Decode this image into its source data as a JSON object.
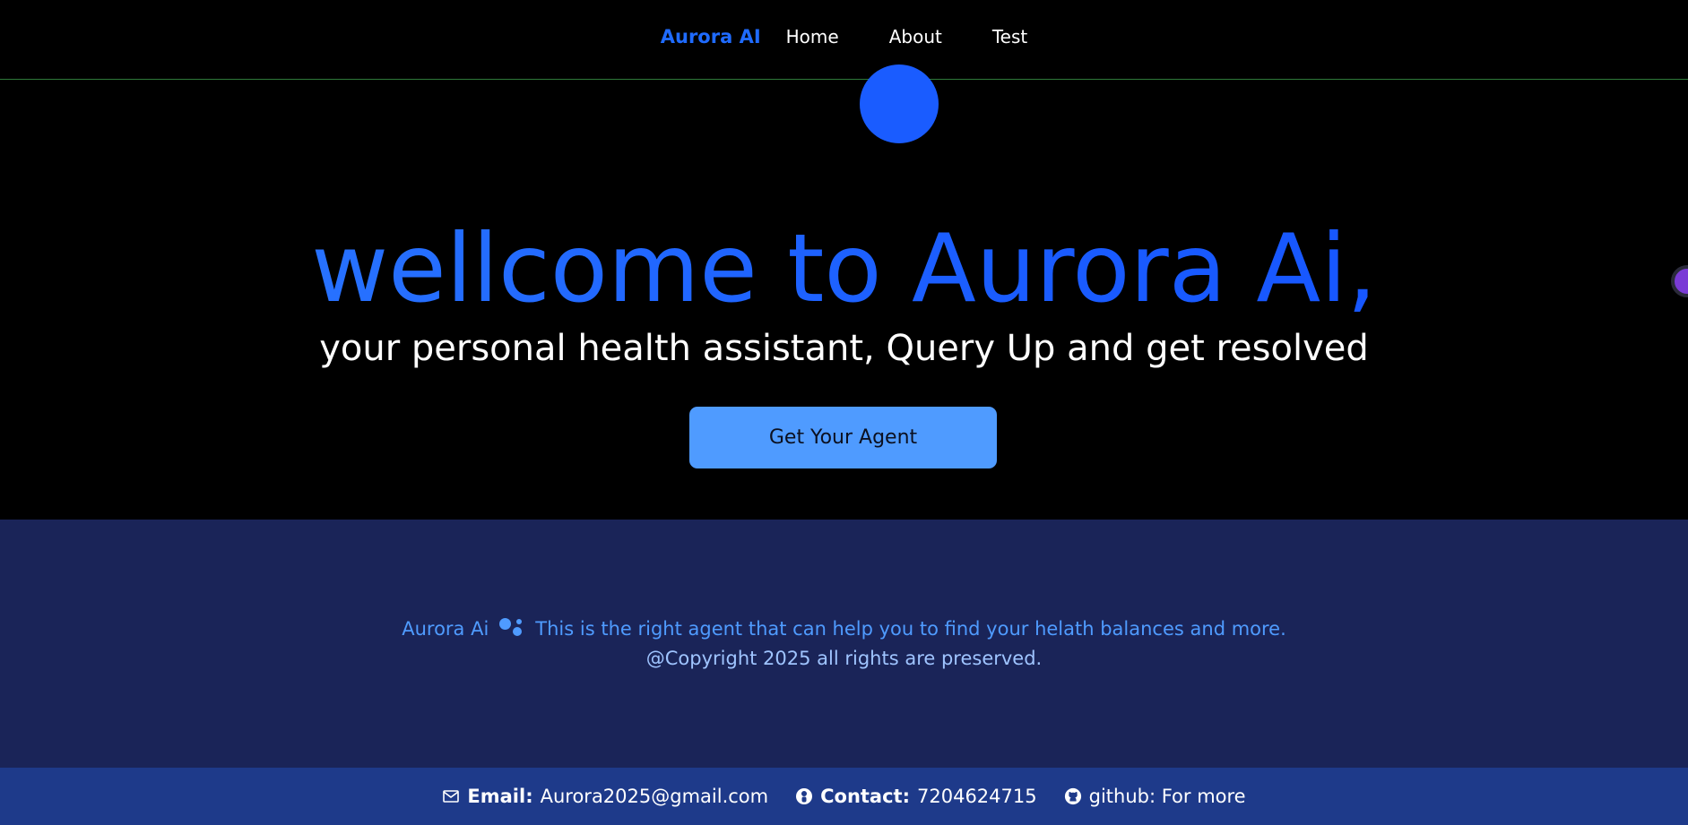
{
  "nav": {
    "brand": "Aurora AI",
    "links": [
      "Home",
      "About",
      "Test"
    ]
  },
  "hero": {
    "title": "wellcome to Aurora Ai,",
    "subtitle": "your personal health assistant, Query Up and get resolved",
    "cta_label": "Get Your Agent"
  },
  "info": {
    "brand": "Aurora Ai",
    "tagline": "This is the right agent that can help you to find your helath balances and more.",
    "copyright": "@Copyright 2025 all rights are preserved."
  },
  "footer": {
    "email_label": "Email:",
    "email_value": "Aurora2025@gmail.com",
    "contact_label": "Contact:",
    "contact_value": "7204624715",
    "github_text": "github: For more"
  },
  "colors": {
    "accent": "#1f6bff",
    "button": "#4f9bff",
    "info_bg": "#1a2458",
    "footer_bg": "#1e3a8a"
  },
  "icons": [
    "mail-icon",
    "contact-icon",
    "github-icon",
    "assistant-dots-icon"
  ]
}
